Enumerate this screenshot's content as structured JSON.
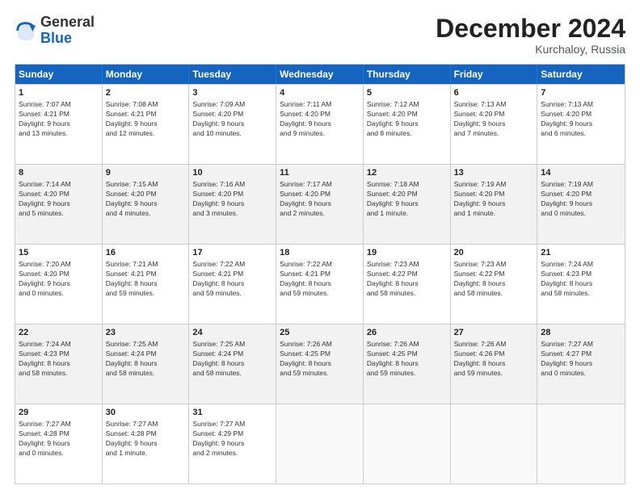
{
  "logo": {
    "general": "General",
    "blue": "Blue"
  },
  "header": {
    "month": "December 2024",
    "location": "Kurchaloy, Russia"
  },
  "weekdays": [
    "Sunday",
    "Monday",
    "Tuesday",
    "Wednesday",
    "Thursday",
    "Friday",
    "Saturday"
  ],
  "rows": [
    [
      {
        "day": "1",
        "lines": [
          "Sunrise: 7:07 AM",
          "Sunset: 4:21 PM",
          "Daylight: 9 hours",
          "and 13 minutes."
        ]
      },
      {
        "day": "2",
        "lines": [
          "Sunrise: 7:08 AM",
          "Sunset: 4:21 PM",
          "Daylight: 9 hours",
          "and 12 minutes."
        ]
      },
      {
        "day": "3",
        "lines": [
          "Sunrise: 7:09 AM",
          "Sunset: 4:20 PM",
          "Daylight: 9 hours",
          "and 10 minutes."
        ]
      },
      {
        "day": "4",
        "lines": [
          "Sunrise: 7:11 AM",
          "Sunset: 4:20 PM",
          "Daylight: 9 hours",
          "and 9 minutes."
        ]
      },
      {
        "day": "5",
        "lines": [
          "Sunrise: 7:12 AM",
          "Sunset: 4:20 PM",
          "Daylight: 9 hours",
          "and 8 minutes."
        ]
      },
      {
        "day": "6",
        "lines": [
          "Sunrise: 7:13 AM",
          "Sunset: 4:20 PM",
          "Daylight: 9 hours",
          "and 7 minutes."
        ]
      },
      {
        "day": "7",
        "lines": [
          "Sunrise: 7:13 AM",
          "Sunset: 4:20 PM",
          "Daylight: 9 hours",
          "and 6 minutes."
        ]
      }
    ],
    [
      {
        "day": "8",
        "lines": [
          "Sunrise: 7:14 AM",
          "Sunset: 4:20 PM",
          "Daylight: 9 hours",
          "and 5 minutes."
        ]
      },
      {
        "day": "9",
        "lines": [
          "Sunrise: 7:15 AM",
          "Sunset: 4:20 PM",
          "Daylight: 9 hours",
          "and 4 minutes."
        ]
      },
      {
        "day": "10",
        "lines": [
          "Sunrise: 7:16 AM",
          "Sunset: 4:20 PM",
          "Daylight: 9 hours",
          "and 3 minutes."
        ]
      },
      {
        "day": "11",
        "lines": [
          "Sunrise: 7:17 AM",
          "Sunset: 4:20 PM",
          "Daylight: 9 hours",
          "and 2 minutes."
        ]
      },
      {
        "day": "12",
        "lines": [
          "Sunrise: 7:18 AM",
          "Sunset: 4:20 PM",
          "Daylight: 9 hours",
          "and 1 minute."
        ]
      },
      {
        "day": "13",
        "lines": [
          "Sunrise: 7:19 AM",
          "Sunset: 4:20 PM",
          "Daylight: 9 hours",
          "and 1 minute."
        ]
      },
      {
        "day": "14",
        "lines": [
          "Sunrise: 7:19 AM",
          "Sunset: 4:20 PM",
          "Daylight: 9 hours",
          "and 0 minutes."
        ]
      }
    ],
    [
      {
        "day": "15",
        "lines": [
          "Sunrise: 7:20 AM",
          "Sunset: 4:20 PM",
          "Daylight: 9 hours",
          "and 0 minutes."
        ]
      },
      {
        "day": "16",
        "lines": [
          "Sunrise: 7:21 AM",
          "Sunset: 4:21 PM",
          "Daylight: 8 hours",
          "and 59 minutes."
        ]
      },
      {
        "day": "17",
        "lines": [
          "Sunrise: 7:22 AM",
          "Sunset: 4:21 PM",
          "Daylight: 8 hours",
          "and 59 minutes."
        ]
      },
      {
        "day": "18",
        "lines": [
          "Sunrise: 7:22 AM",
          "Sunset: 4:21 PM",
          "Daylight: 8 hours",
          "and 59 minutes."
        ]
      },
      {
        "day": "19",
        "lines": [
          "Sunrise: 7:23 AM",
          "Sunset: 4:22 PM",
          "Daylight: 8 hours",
          "and 58 minutes."
        ]
      },
      {
        "day": "20",
        "lines": [
          "Sunrise: 7:23 AM",
          "Sunset: 4:22 PM",
          "Daylight: 8 hours",
          "and 58 minutes."
        ]
      },
      {
        "day": "21",
        "lines": [
          "Sunrise: 7:24 AM",
          "Sunset: 4:23 PM",
          "Daylight: 8 hours",
          "and 58 minutes."
        ]
      }
    ],
    [
      {
        "day": "22",
        "lines": [
          "Sunrise: 7:24 AM",
          "Sunset: 4:23 PM",
          "Daylight: 8 hours",
          "and 58 minutes."
        ]
      },
      {
        "day": "23",
        "lines": [
          "Sunrise: 7:25 AM",
          "Sunset: 4:24 PM",
          "Daylight: 8 hours",
          "and 58 minutes."
        ]
      },
      {
        "day": "24",
        "lines": [
          "Sunrise: 7:25 AM",
          "Sunset: 4:24 PM",
          "Daylight: 8 hours",
          "and 58 minutes."
        ]
      },
      {
        "day": "25",
        "lines": [
          "Sunrise: 7:26 AM",
          "Sunset: 4:25 PM",
          "Daylight: 8 hours",
          "and 59 minutes."
        ]
      },
      {
        "day": "26",
        "lines": [
          "Sunrise: 7:26 AM",
          "Sunset: 4:25 PM",
          "Daylight: 8 hours",
          "and 59 minutes."
        ]
      },
      {
        "day": "27",
        "lines": [
          "Sunrise: 7:26 AM",
          "Sunset: 4:26 PM",
          "Daylight: 8 hours",
          "and 59 minutes."
        ]
      },
      {
        "day": "28",
        "lines": [
          "Sunrise: 7:27 AM",
          "Sunset: 4:27 PM",
          "Daylight: 9 hours",
          "and 0 minutes."
        ]
      }
    ],
    [
      {
        "day": "29",
        "lines": [
          "Sunrise: 7:27 AM",
          "Sunset: 4:28 PM",
          "Daylight: 9 hours",
          "and 0 minutes."
        ]
      },
      {
        "day": "30",
        "lines": [
          "Sunrise: 7:27 AM",
          "Sunset: 4:28 PM",
          "Daylight: 9 hours",
          "and 1 minute."
        ]
      },
      {
        "day": "31",
        "lines": [
          "Sunrise: 7:27 AM",
          "Sunset: 4:29 PM",
          "Daylight: 9 hours",
          "and 2 minutes."
        ]
      },
      null,
      null,
      null,
      null
    ]
  ]
}
